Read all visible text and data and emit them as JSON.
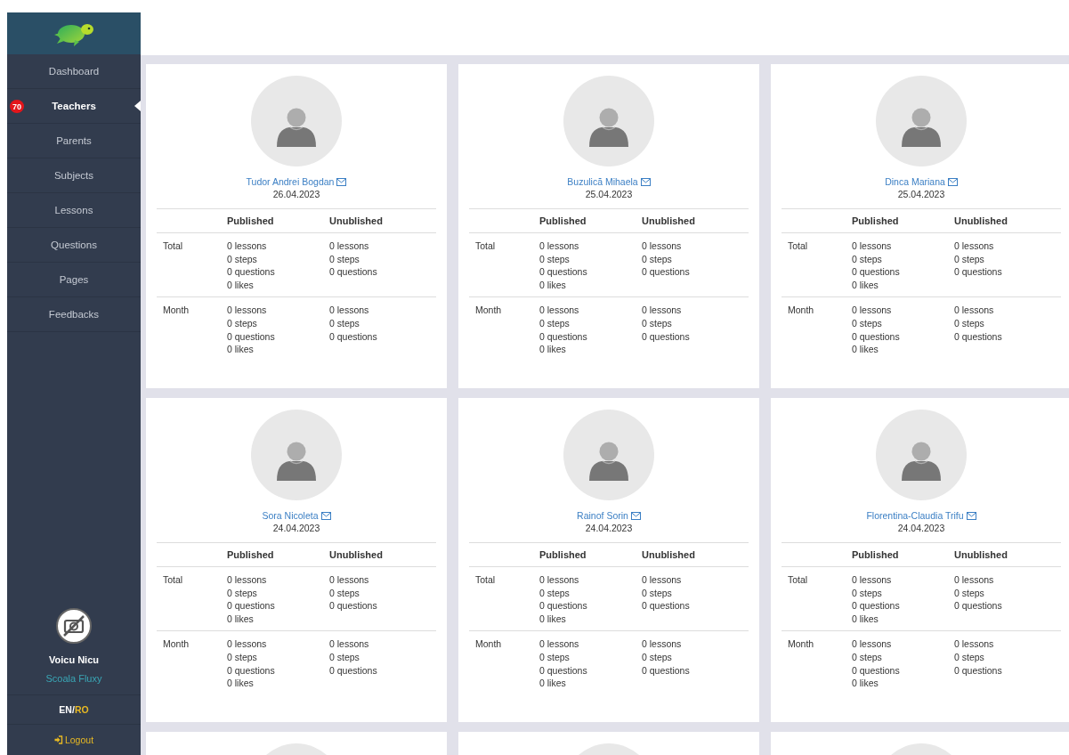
{
  "sidebar": {
    "nav": [
      {
        "label": "Dashboard",
        "selected": false
      },
      {
        "label": "Teachers",
        "selected": true,
        "badge": "70"
      },
      {
        "label": "Parents",
        "selected": false
      },
      {
        "label": "Subjects",
        "selected": false
      },
      {
        "label": "Lessons",
        "selected": false
      },
      {
        "label": "Questions",
        "selected": false
      },
      {
        "label": "Pages",
        "selected": false
      },
      {
        "label": "Feedbacks",
        "selected": false
      }
    ],
    "user": {
      "name": "Voicu Nicu",
      "school": "Scoala Fluxy"
    },
    "languages": {
      "options": [
        {
          "label": "EN",
          "selected": true
        },
        {
          "label": "RO",
          "selected": false
        }
      ],
      "separator": "/"
    },
    "logout": "Logout"
  },
  "cards": [
    {
      "kind": "full",
      "name": "Tudor Andrei Bogdan",
      "date": "26.04.2023",
      "columns": [
        "Published",
        "Unublished"
      ],
      "rows": [
        {
          "label": "Total",
          "published": [
            "0 lessons",
            "0 steps",
            "0 questions",
            "0 likes"
          ],
          "unpublished": [
            "0 lessons",
            "0 steps",
            "0 questions"
          ]
        },
        {
          "label": "Month",
          "published": [
            "0 lessons",
            "0 steps",
            "0 questions",
            "0 likes"
          ],
          "unpublished": [
            "0 lessons",
            "0 steps",
            "0 questions"
          ]
        }
      ]
    },
    {
      "kind": "full",
      "name": "Buzulică Mihaela",
      "date": "25.04.2023",
      "columns": [
        "Published",
        "Unublished"
      ],
      "rows": [
        {
          "label": "Total",
          "published": [
            "0 lessons",
            "0 steps",
            "0 questions",
            "0 likes"
          ],
          "unpublished": [
            "0 lessons",
            "0 steps",
            "0 questions"
          ]
        },
        {
          "label": "Month",
          "published": [
            "0 lessons",
            "0 steps",
            "0 questions",
            "0 likes"
          ],
          "unpublished": [
            "0 lessons",
            "0 steps",
            "0 questions"
          ]
        }
      ]
    },
    {
      "kind": "full",
      "name": "Dinca Mariana",
      "date": "25.04.2023",
      "columns": [
        "Published",
        "Unublished"
      ],
      "rows": [
        {
          "label": "Total",
          "published": [
            "0 lessons",
            "0 steps",
            "0 questions",
            "0 likes"
          ],
          "unpublished": [
            "0 lessons",
            "0 steps",
            "0 questions"
          ]
        },
        {
          "label": "Month",
          "published": [
            "0 lessons",
            "0 steps",
            "0 questions",
            "0 likes"
          ],
          "unpublished": [
            "0 lessons",
            "0 steps",
            "0 questions"
          ]
        }
      ]
    },
    {
      "kind": "full",
      "name": "Sora Nicoleta",
      "date": "24.04.2023",
      "columns": [
        "Published",
        "Unublished"
      ],
      "rows": [
        {
          "label": "Total",
          "published": [
            "0 lessons",
            "0 steps",
            "0 questions",
            "0 likes"
          ],
          "unpublished": [
            "0 lessons",
            "0 steps",
            "0 questions"
          ]
        },
        {
          "label": "Month",
          "published": [
            "0 lessons",
            "0 steps",
            "0 questions",
            "0 likes"
          ],
          "unpublished": [
            "0 lessons",
            "0 steps",
            "0 questions"
          ]
        }
      ]
    },
    {
      "kind": "full",
      "name": "Rainof Sorin",
      "date": "24.04.2023",
      "columns": [
        "Published",
        "Unublished"
      ],
      "rows": [
        {
          "label": "Total",
          "published": [
            "0 lessons",
            "0 steps",
            "0 questions",
            "0 likes"
          ],
          "unpublished": [
            "0 lessons",
            "0 steps",
            "0 questions"
          ]
        },
        {
          "label": "Month",
          "published": [
            "0 lessons",
            "0 steps",
            "0 questions",
            "0 likes"
          ],
          "unpublished": [
            "0 lessons",
            "0 steps",
            "0 questions"
          ]
        }
      ]
    },
    {
      "kind": "full",
      "name": "Florentina-Claudia Trifu",
      "date": "24.04.2023",
      "columns": [
        "Published",
        "Unublished"
      ],
      "rows": [
        {
          "label": "Total",
          "published": [
            "0 lessons",
            "0 steps",
            "0 questions",
            "0 likes"
          ],
          "unpublished": [
            "0 lessons",
            "0 steps",
            "0 questions"
          ]
        },
        {
          "label": "Month",
          "published": [
            "0 lessons",
            "0 steps",
            "0 questions",
            "0 likes"
          ],
          "unpublished": [
            "0 lessons",
            "0 steps",
            "0 questions"
          ]
        }
      ]
    },
    {
      "kind": "cut"
    },
    {
      "kind": "cut"
    },
    {
      "kind": "cut"
    }
  ]
}
